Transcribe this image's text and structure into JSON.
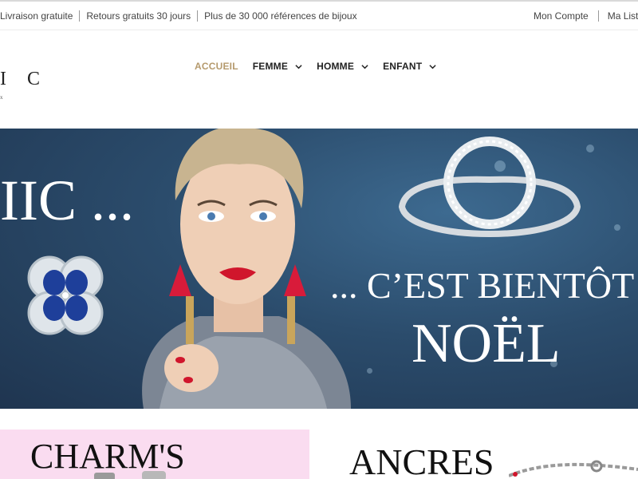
{
  "topbar": {
    "promos": [
      "Livraison gratuite",
      "Retours gratuits 30 jours",
      "Plus de 30 000 références de bijoux"
    ],
    "account_link": "Mon Compte",
    "wishlist_link": "Ma Liste D"
  },
  "brand": {
    "logo_text": "I C",
    "tagline": "x"
  },
  "nav": {
    "items": [
      {
        "label": "ACCUEIL",
        "active": true
      },
      {
        "label": "FEMME",
        "dropdown": true
      },
      {
        "label": "HOMME",
        "dropdown": true
      },
      {
        "label": "ENFANT",
        "dropdown": true
      }
    ],
    "accent_color": "#b59a6d"
  },
  "hero": {
    "text_left": "IIC ...",
    "text_mid": "... C’EST BIENTÔT",
    "text_main": "NOËL",
    "background_color": "#2f5272"
  },
  "tiles": {
    "left_title": "CHARM'S",
    "left_color": "#fadcf0",
    "right_title": "ANCRES"
  }
}
